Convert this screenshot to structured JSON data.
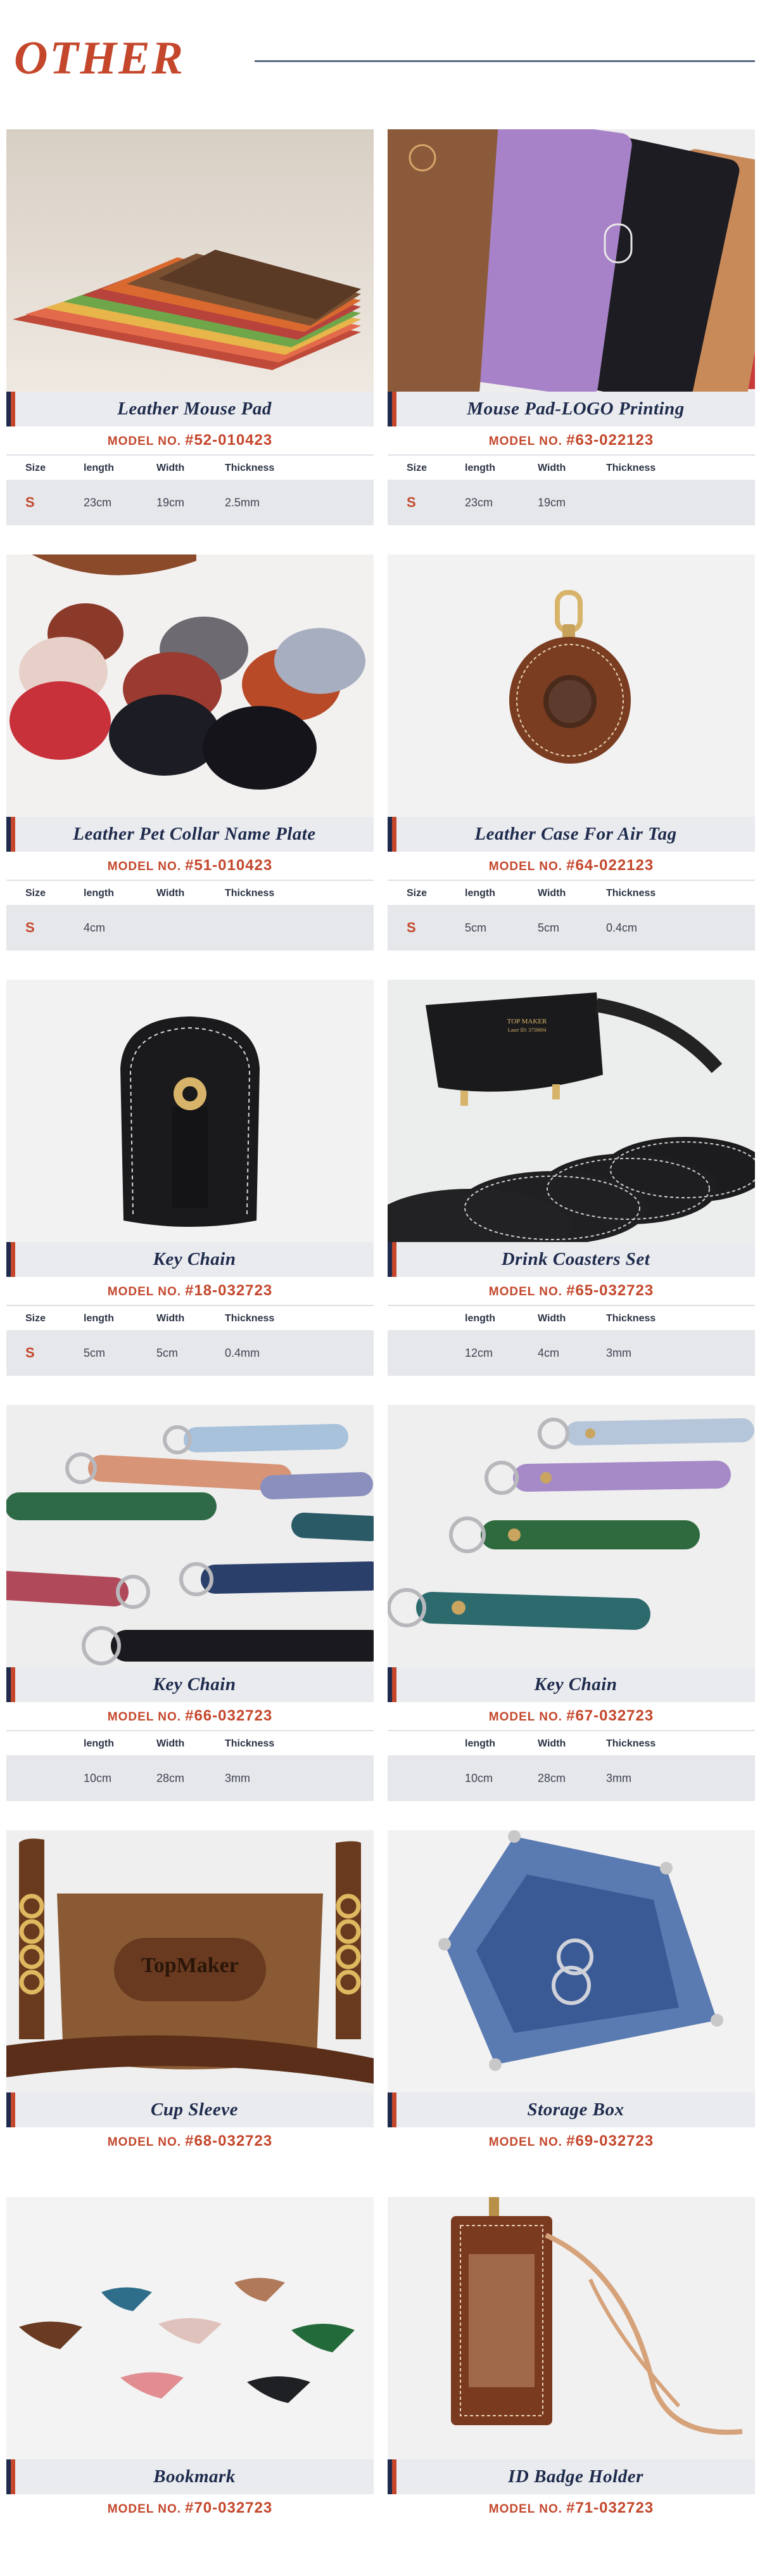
{
  "page": {
    "title": "OTHER"
  },
  "colors": {
    "brand_red": "#c4472c",
    "navy": "#1f2b4d",
    "name_bar": "#e9ebef",
    "spec_values_bg": "#e6e7ea"
  },
  "spec_labels": {
    "size": "Size",
    "length": "length",
    "width": "Width",
    "thickness": "Thickness"
  },
  "model_label": "MODEL NO.",
  "products": [
    {
      "name": "Leather Mouse Pad",
      "model": "#52-010423",
      "size": "S",
      "length": "23cm",
      "width": "19cm",
      "thickness": "2.5mm",
      "image": "stacked-colored-mouse-pads"
    },
    {
      "name": "Mouse Pad-LOGO Printing",
      "model": "#63-022123",
      "size": "S",
      "length": "23cm",
      "width": "19cm",
      "thickness": "",
      "image": "logo-printed-mouse-pads"
    },
    {
      "name": "Leather Pet Collar Name Plate",
      "model": "#51-010423",
      "size": "S",
      "length": "4cm",
      "width": "",
      "thickness": "",
      "image": "round-money-tags"
    },
    {
      "name": "Leather Case For Air Tag",
      "model": "#64-022123",
      "size": "S",
      "length": "5cm",
      "width": "5cm",
      "thickness": "0.4cm",
      "image": "air-tag-leather-case"
    },
    {
      "name": "Key Chain",
      "model": "#18-032723",
      "size": "S",
      "length": "5cm",
      "width": "5cm",
      "thickness": "0.4mm",
      "image": "black-key-pouch"
    },
    {
      "name": "Drink Coasters Set",
      "model": "#65-032723",
      "size": "",
      "length": "12cm",
      "width": "4cm",
      "thickness": "3mm",
      "image": "black-coaster-set-with-holder",
      "holder_text": [
        "TOP MAKER",
        "Laser ID: 3758694"
      ]
    },
    {
      "name": "Key Chain",
      "model": "#66-032723",
      "size": "",
      "length": "10cm",
      "width": "28cm",
      "thickness": "3mm",
      "image": "colorful-strap-key-chains"
    },
    {
      "name": "Key Chain",
      "model": "#67-032723",
      "size": "",
      "length": "10cm",
      "width": "28cm",
      "thickness": "3mm",
      "image": "pastel-strap-key-chains"
    },
    {
      "name": "Cup Sleeve",
      "model": "#68-032723",
      "image": "brown-cup-sleeve",
      "brand_plate": "TopMaker"
    },
    {
      "name": "Storage Box",
      "model": "#69-032723",
      "image": "blue-leather-tray"
    },
    {
      "name": "Bookmark",
      "model": "#70-032723",
      "image": "corner-bookmarks"
    },
    {
      "name": "ID Badge Holder",
      "model": "#71-032723",
      "image": "brown-badge-holder"
    }
  ]
}
